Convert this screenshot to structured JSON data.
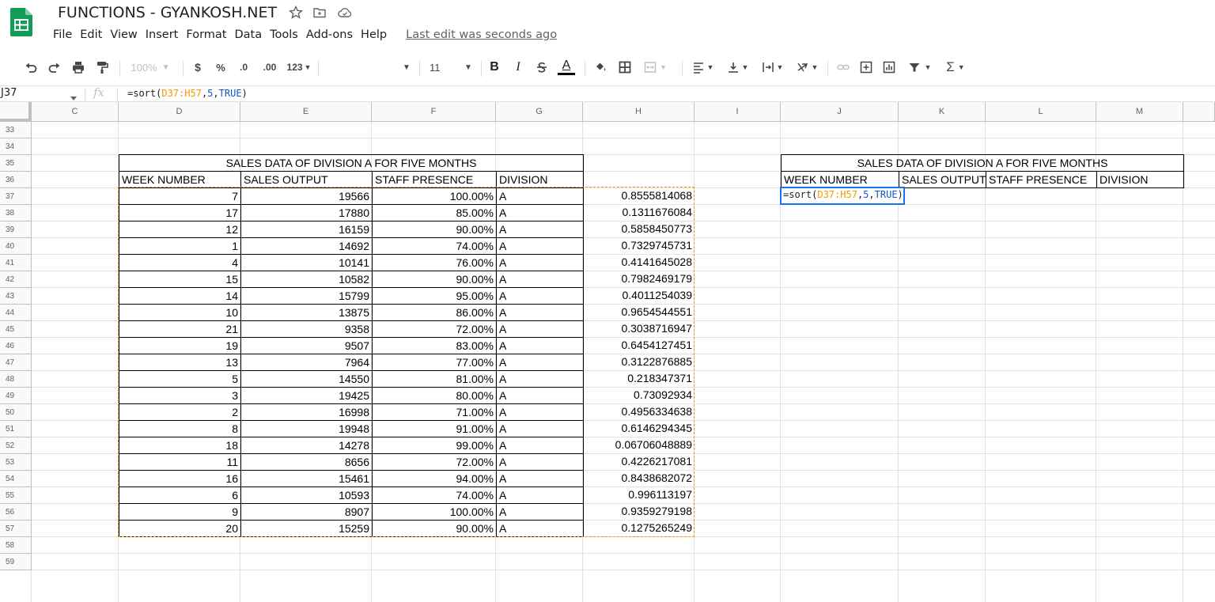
{
  "title_bar": {
    "doc_title": "FUNCTIONS - GYANKOSH.NET",
    "icons": [
      "star-icon",
      "move-to-folder-icon",
      "cloud-status-icon"
    ]
  },
  "menu": {
    "items": [
      "File",
      "Edit",
      "View",
      "Insert",
      "Format",
      "Data",
      "Tools",
      "Add-ons",
      "Help"
    ],
    "last_edit": "Last edit was seconds ago"
  },
  "toolbar": {
    "zoom": "100%",
    "currency": "$",
    "percent": "%",
    "decrease_decimal": ".0",
    "increase_decimal": ".00",
    "more_formats": "123",
    "font_size": "11",
    "bold": "B",
    "italic": "I",
    "text_color_letter": "A"
  },
  "formula_bar": {
    "cell_ref": "J37",
    "fx": "fx",
    "formula_prefix": "=sort(",
    "formula_range": "D37:H57",
    "formula_sep1": ",",
    "formula_arg1": "5",
    "formula_sep2": ",",
    "formula_arg2": "TRUE",
    "formula_suffix": ")"
  },
  "columns": [
    "C",
    "D",
    "E",
    "F",
    "G",
    "H",
    "I",
    "J",
    "K",
    "L",
    "M"
  ],
  "rows": [
    "33",
    "34",
    "35",
    "36",
    "37",
    "38",
    "39",
    "40",
    "41",
    "42",
    "43",
    "44",
    "45",
    "46",
    "47",
    "48",
    "49",
    "50",
    "51",
    "52",
    "53",
    "54",
    "55",
    "56",
    "57",
    "58",
    "59"
  ],
  "left_table": {
    "title": "SALES DATA OF DIVISION A FOR FIVE MONTHS",
    "headers": [
      "WEEK NUMBER",
      "SALES OUTPUT",
      "STAFF PRESENCE",
      "DIVISION"
    ],
    "rows": [
      [
        "7",
        "19566",
        "100.00%",
        "A",
        "0.8555814068"
      ],
      [
        "17",
        "17880",
        "85.00%",
        "A",
        "0.1311676084"
      ],
      [
        "12",
        "16159",
        "90.00%",
        "A",
        "0.5858450773"
      ],
      [
        "1",
        "14692",
        "74.00%",
        "A",
        "0.7329745731"
      ],
      [
        "4",
        "10141",
        "76.00%",
        "A",
        "0.4141645028"
      ],
      [
        "15",
        "10582",
        "90.00%",
        "A",
        "0.7982469179"
      ],
      [
        "14",
        "15799",
        "95.00%",
        "A",
        "0.4011254039"
      ],
      [
        "10",
        "13875",
        "86.00%",
        "A",
        "0.9654544551"
      ],
      [
        "21",
        "9358",
        "72.00%",
        "A",
        "0.3038716947"
      ],
      [
        "19",
        "9507",
        "83.00%",
        "A",
        "0.6454127451"
      ],
      [
        "13",
        "7964",
        "77.00%",
        "A",
        "0.3122876885"
      ],
      [
        "5",
        "14550",
        "81.00%",
        "A",
        "0.218347371"
      ],
      [
        "3",
        "19425",
        "80.00%",
        "A",
        "0.73092934"
      ],
      [
        "2",
        "16998",
        "71.00%",
        "A",
        "0.4956334638"
      ],
      [
        "8",
        "19948",
        "91.00%",
        "A",
        "0.6146294345"
      ],
      [
        "18",
        "14278",
        "99.00%",
        "A",
        "0.06706048889"
      ],
      [
        "11",
        "8656",
        "72.00%",
        "A",
        "0.4226217081"
      ],
      [
        "16",
        "15461",
        "94.00%",
        "A",
        "0.8438682072"
      ],
      [
        "6",
        "10593",
        "74.00%",
        "A",
        "0.996113197"
      ],
      [
        "9",
        "8907",
        "100.00%",
        "A",
        "0.9359279198"
      ],
      [
        "20",
        "15259",
        "90.00%",
        "A",
        "0.1275265249"
      ]
    ]
  },
  "right_table": {
    "title": "SALES DATA OF DIVISION A FOR FIVE MONTHS",
    "headers": [
      "WEEK NUMBER",
      "SALES OUTPUT",
      "STAFF PRESENCE",
      "DIVISION"
    ]
  },
  "active_cell": {
    "ref": "J37"
  },
  "colors": {
    "sheets_green": "#0f9d58",
    "selection_blue": "#1a73e8",
    "range_orange": "#f29900",
    "number_blue": "#1155cc"
  }
}
